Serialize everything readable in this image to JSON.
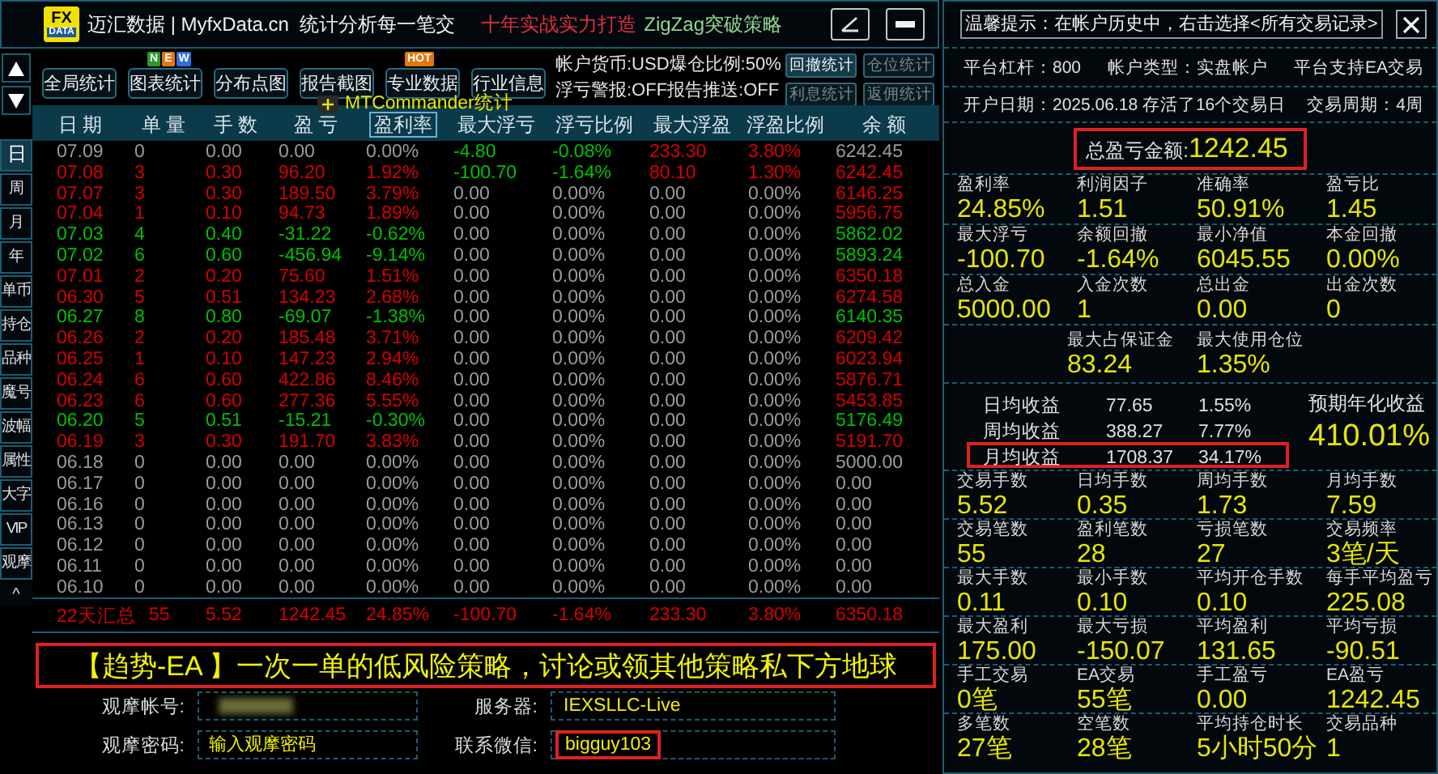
{
  "header": {
    "logo": [
      "FX",
      "DATA"
    ],
    "title": "迈汇数据 | MyfxData.cn  统计分析每一笔交",
    "slogan": "十年实战实力打造",
    "strategy": "ZigZag突破策略"
  },
  "sidebar": {
    "tabs": [
      {
        "label": "日",
        "selected": true
      },
      {
        "label": "周",
        "selected": false
      },
      {
        "label": "月",
        "selected": false
      },
      {
        "label": "年",
        "selected": false
      },
      {
        "label": "单币",
        "selected": false
      },
      {
        "label": "持仓",
        "selected": false
      },
      {
        "label": "品种",
        "selected": false
      },
      {
        "label": "魔号",
        "selected": false
      },
      {
        "label": "波幅",
        "selected": false
      },
      {
        "label": "属性",
        "selected": false
      },
      {
        "label": "大字",
        "selected": false
      },
      {
        "label": "VIP",
        "selected": false
      },
      {
        "label": "观摩",
        "selected": false
      }
    ],
    "collapse": "^"
  },
  "toolbar": {
    "buttons": [
      {
        "label": "全局统计"
      },
      {
        "label": "图表统计",
        "badges": [
          {
            "text": "N",
            "color": "#2a9a2a"
          },
          {
            "text": "E",
            "color": "#e07810"
          },
          {
            "text": "W",
            "color": "#2a70e0"
          }
        ]
      },
      {
        "label": "分布点图"
      },
      {
        "label": "报告截图"
      },
      {
        "label": "专业数据",
        "badges": [
          {
            "text": "HOT",
            "color": "#e07810"
          }
        ]
      },
      {
        "label": "行业信息"
      }
    ],
    "info": [
      "帐户货币:USD爆仓比例:50%",
      "浮亏警报:OFF报告推送:OFF"
    ],
    "small_buttons": [
      {
        "label": "回撤统计",
        "disabled": false
      },
      {
        "label": "仓位统计",
        "disabled": true
      },
      {
        "label": "利息统计",
        "disabled": true
      },
      {
        "label": "返佣统计",
        "disabled": true
      }
    ]
  },
  "table": {
    "tooltip": "MTCommander统计",
    "columns": [
      {
        "label": "日 期",
        "selected": false
      },
      {
        "label": "单 量",
        "selected": false
      },
      {
        "label": "手 数",
        "selected": false
      },
      {
        "label": "盈 亏",
        "selected": false
      },
      {
        "label": "盈利率",
        "selected": true
      },
      {
        "label": "最大浮亏",
        "selected": false
      },
      {
        "label": "浮亏比例",
        "selected": false
      },
      {
        "label": "最大浮盈",
        "selected": false
      },
      {
        "label": "浮盈比例",
        "selected": false
      },
      {
        "label": "余 额",
        "selected": false
      }
    ],
    "rows": [
      {
        "color": "#9a9a9a",
        "cells": [
          "07.09",
          "0",
          "0.00",
          "0.00",
          "0.00%"
        ],
        "floats": [
          {
            "text": "-4.80",
            "color": "#00c000"
          },
          {
            "text": "-0.08%",
            "color": "#00c000"
          },
          {
            "text": "233.30",
            "color": "#d40000"
          },
          {
            "text": "3.80%",
            "color": "#d40000"
          }
        ],
        "balance": "6242.45"
      },
      {
        "color": "#d40000",
        "cells": [
          "07.08",
          "3",
          "0.30",
          "96.20",
          "1.92%"
        ],
        "floats": [
          {
            "text": "-100.70",
            "color": "#00c000"
          },
          {
            "text": "-1.64%",
            "color": "#00c000"
          },
          {
            "text": "80.10",
            "color": "#d40000"
          },
          {
            "text": "1.30%",
            "color": "#d40000"
          }
        ],
        "balance": "6242.45"
      },
      {
        "color": "#d40000",
        "cells": [
          "07.07",
          "3",
          "0.30",
          "189.50",
          "3.79%",
          "0.00",
          "0.00%",
          "0.00",
          "0.00%",
          "6146.25"
        ]
      },
      {
        "color": "#d40000",
        "cells": [
          "07.04",
          "1",
          "0.10",
          "94.73",
          "1.89%",
          "0.00",
          "0.00%",
          "0.00",
          "0.00%",
          "5956.75"
        ]
      },
      {
        "color": "#00c000",
        "cells": [
          "07.03",
          "4",
          "0.40",
          "-31.22",
          "-0.62%",
          "0.00",
          "0.00%",
          "0.00",
          "0.00%",
          "5862.02"
        ]
      },
      {
        "color": "#00c000",
        "cells": [
          "07.02",
          "6",
          "0.60",
          "-456.94",
          "-9.14%",
          "0.00",
          "0.00%",
          "0.00",
          "0.00%",
          "5893.24"
        ]
      },
      {
        "color": "#d40000",
        "cells": [
          "07.01",
          "2",
          "0.20",
          "75.60",
          "1.51%",
          "0.00",
          "0.00%",
          "0.00",
          "0.00%",
          "6350.18"
        ]
      },
      {
        "color": "#d40000",
        "cells": [
          "06.30",
          "5",
          "0.51",
          "134.23",
          "2.68%",
          "0.00",
          "0.00%",
          "0.00",
          "0.00%",
          "6274.58"
        ]
      },
      {
        "color": "#00c000",
        "cells": [
          "06.27",
          "8",
          "0.80",
          "-69.07",
          "-1.38%",
          "0.00",
          "0.00%",
          "0.00",
          "0.00%",
          "6140.35"
        ]
      },
      {
        "color": "#d40000",
        "cells": [
          "06.26",
          "2",
          "0.20",
          "185.48",
          "3.71%",
          "0.00",
          "0.00%",
          "0.00",
          "0.00%",
          "6209.42"
        ]
      },
      {
        "color": "#d40000",
        "cells": [
          "06.25",
          "1",
          "0.10",
          "147.23",
          "2.94%",
          "0.00",
          "0.00%",
          "0.00",
          "0.00%",
          "6023.94"
        ]
      },
      {
        "color": "#d40000",
        "cells": [
          "06.24",
          "6",
          "0.60",
          "422.86",
          "8.46%",
          "0.00",
          "0.00%",
          "0.00",
          "0.00%",
          "5876.71"
        ]
      },
      {
        "color": "#d40000",
        "cells": [
          "06.23",
          "6",
          "0.60",
          "277.36",
          "5.55%",
          "0.00",
          "0.00%",
          "0.00",
          "0.00%",
          "5453.85"
        ]
      },
      {
        "color": "#00c000",
        "cells": [
          "06.20",
          "5",
          "0.51",
          "-15.21",
          "-0.30%",
          "0.00",
          "0.00%",
          "0.00",
          "0.00%",
          "5176.49"
        ]
      },
      {
        "color": "#d40000",
        "cells": [
          "06.19",
          "3",
          "0.30",
          "191.70",
          "3.83%",
          "0.00",
          "0.00%",
          "0.00",
          "0.00%",
          "5191.70"
        ]
      },
      {
        "color": "#9a9a9a",
        "cells": [
          "06.18",
          "0",
          "0.00",
          "0.00",
          "0.00%",
          "0.00",
          "0.00%",
          "0.00",
          "0.00%",
          "5000.00"
        ]
      },
      {
        "color": "#9a9a9a",
        "cells": [
          "06.17",
          "0",
          "0.00",
          "0.00",
          "0.00%",
          "0.00",
          "0.00%",
          "0.00",
          "0.00%",
          "0.00"
        ]
      },
      {
        "color": "#9a9a9a",
        "cells": [
          "06.16",
          "0",
          "0.00",
          "0.00",
          "0.00%",
          "0.00",
          "0.00%",
          "0.00",
          "0.00%",
          "0.00"
        ]
      },
      {
        "color": "#9a9a9a",
        "cells": [
          "06.13",
          "0",
          "0.00",
          "0.00",
          "0.00%",
          "0.00",
          "0.00%",
          "0.00",
          "0.00%",
          "0.00"
        ]
      },
      {
        "color": "#9a9a9a",
        "cells": [
          "06.12",
          "0",
          "0.00",
          "0.00",
          "0.00%",
          "0.00",
          "0.00%",
          "0.00",
          "0.00%",
          "0.00"
        ]
      },
      {
        "color": "#9a9a9a",
        "cells": [
          "06.11",
          "0",
          "0.00",
          "0.00",
          "0.00%",
          "0.00",
          "0.00%",
          "0.00",
          "0.00%",
          "0.00"
        ]
      },
      {
        "color": "#9a9a9a",
        "cells": [
          "06.10",
          "0",
          "0.00",
          "0.00",
          "0.00%",
          "0.00",
          "0.00%",
          "0.00",
          "0.00%",
          "0.00"
        ]
      }
    ],
    "summary": {
      "cells": [
        "22天汇总",
        "55",
        "5.52",
        "1242.45",
        "24.85%",
        "-100.70",
        "-1.64%",
        "233.30",
        "3.80%",
        "6350.18"
      ]
    }
  },
  "banner": {
    "text": "【趋势-EA 】一次一单的低风险策略，讨论或领其他策略私下方地球",
    "highlighted": true
  },
  "fields": [
    {
      "kind": "redacted",
      "label": "观摩帐号:"
    },
    {
      "kind": "value",
      "label": "服务器:",
      "value": "IEXSLLC-Live",
      "highlighted": false
    },
    {
      "kind": "input",
      "label": "观摩密码:",
      "placeholder": "输入观摩密码"
    },
    {
      "kind": "value",
      "label": "联系微信:",
      "value": "bigguy103",
      "highlighted": true
    }
  ],
  "stats": {
    "tip": "温馨提示：在帐户历史中，右击选择<所有交易记录>",
    "info_rows": [
      {
        "items": [
          "平台杠杆：800",
          "帐户类型：实盘帐户",
          "平台支持EA交易"
        ]
      },
      {
        "items": [
          "开户日期：2025.06.18 存活了16个交易日",
          "交易周期：4周"
        ]
      }
    ],
    "total": {
      "label": "总盈亏金额:",
      "value": "1242.45",
      "highlighted": true
    },
    "groups": [
      {
        "kind": "grid",
        "items": [
          {
            "label": "盈利率",
            "value": "24.85%"
          },
          {
            "label": "利润因子",
            "value": "1.51"
          },
          {
            "label": "准确率",
            "value": "50.91%"
          },
          {
            "label": "盈亏比",
            "value": "1.45"
          }
        ]
      },
      {
        "kind": "grid",
        "items": [
          {
            "label": "最大浮亏",
            "value": "-100.70"
          },
          {
            "label": "余额回撤",
            "value": "-1.64%"
          },
          {
            "label": "最小净值",
            "value": "6045.55"
          },
          {
            "label": "本金回撤",
            "value": "0.00%"
          }
        ]
      },
      {
        "kind": "grid",
        "items": [
          {
            "label": "总入金",
            "value": "5000.00"
          },
          {
            "label": "入金次数",
            "value": "1"
          },
          {
            "label": "总出金",
            "value": "0.00"
          },
          {
            "label": "出金次数",
            "value": "0"
          }
        ]
      },
      {
        "kind": "centered",
        "items": [
          {
            "label": "最大占保证金",
            "value": "83.24"
          },
          {
            "label": "最大使用仓位",
            "value": "1.35%"
          }
        ]
      }
    ],
    "returns": {
      "rows": [
        {
          "label": "日均收益",
          "amount": "77.65",
          "percent": "1.55%",
          "highlighted": false
        },
        {
          "label": "周均收益",
          "amount": "388.27",
          "percent": "7.77%",
          "highlighted": false
        },
        {
          "label": "月均收益",
          "amount": "1708.37",
          "percent": "34.17%",
          "highlighted": true
        }
      ],
      "annual": {
        "label": "预期年化收益",
        "value": "410.01%"
      }
    },
    "groups_bottom": [
      {
        "kind": "grid",
        "items": [
          {
            "label": "交易手数",
            "value": "5.52"
          },
          {
            "label": "日均手数",
            "value": "0.35"
          },
          {
            "label": "周均手数",
            "value": "1.73"
          },
          {
            "label": "月均手数",
            "value": "7.59"
          }
        ]
      },
      {
        "kind": "grid",
        "items": [
          {
            "label": "交易笔数",
            "value": "55"
          },
          {
            "label": "盈利笔数",
            "value": "28"
          },
          {
            "label": "亏损笔数",
            "value": "27"
          },
          {
            "label": "交易频率",
            "value": "3笔/天"
          }
        ]
      },
      {
        "kind": "grid",
        "items": [
          {
            "label": "最大手数",
            "value": "0.11"
          },
          {
            "label": "最小手数",
            "value": "0.10"
          },
          {
            "label": "平均开仓手数",
            "value": "0.10"
          },
          {
            "label": "每手平均盈亏",
            "value": "225.08"
          }
        ]
      },
      {
        "kind": "grid",
        "items": [
          {
            "label": "最大盈利",
            "value": "175.00"
          },
          {
            "label": "最大亏损",
            "value": "-150.07"
          },
          {
            "label": "平均盈利",
            "value": "131.65"
          },
          {
            "label": "平均亏损",
            "value": "-90.51"
          }
        ]
      },
      {
        "kind": "grid",
        "items": [
          {
            "label": "手工交易",
            "value": "0笔"
          },
          {
            "label": "EA交易",
            "value": "55笔"
          },
          {
            "label": "手工盈亏",
            "value": "0.00"
          },
          {
            "label": "EA盈亏",
            "value": "1242.45"
          }
        ]
      },
      {
        "kind": "grid",
        "items": [
          {
            "label": "多笔数",
            "value": "27笔"
          },
          {
            "label": "空笔数",
            "value": "28笔"
          },
          {
            "label": "平均持仓时长",
            "value": "5小时50分"
          },
          {
            "label": "交易品种",
            "value": "1"
          }
        ]
      }
    ]
  }
}
